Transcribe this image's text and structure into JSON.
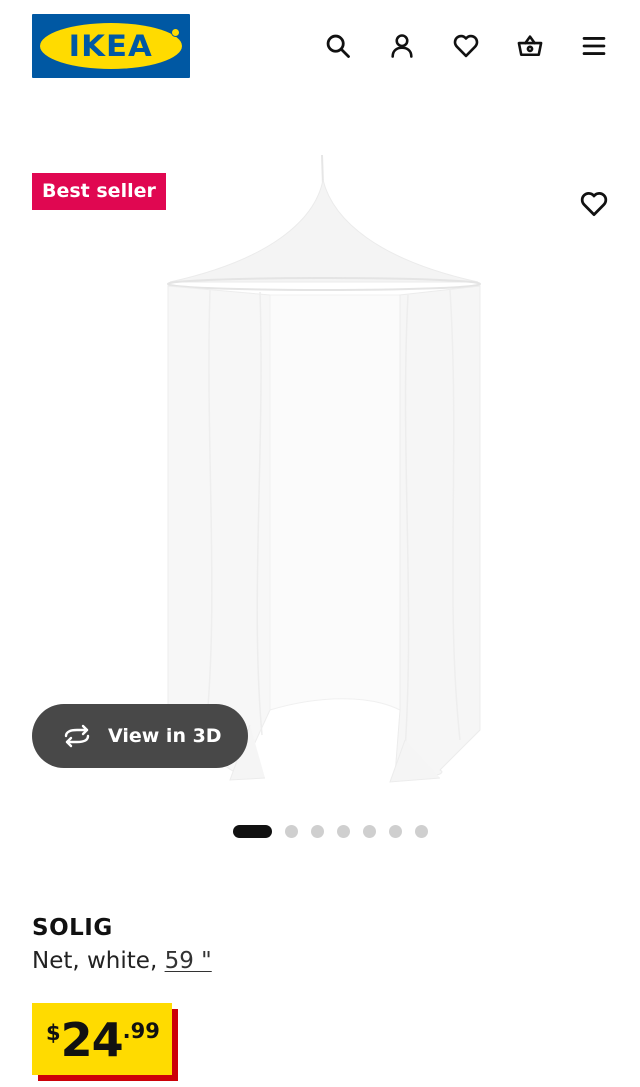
{
  "header": {
    "logo_text": "IKEA",
    "icons": [
      "search-icon",
      "account-icon",
      "heart-icon",
      "basket-icon",
      "menu-icon"
    ]
  },
  "product_media": {
    "badge": "Best seller",
    "view_3d_label": "View in 3D",
    "carousel": {
      "total": 7,
      "active_index": 1
    }
  },
  "product": {
    "name": "SOLIG",
    "description_prefix": "Net, white,",
    "size_link": "59 \"",
    "price": {
      "currency": "$",
      "whole": "24",
      "decimal": ".99"
    }
  },
  "colors": {
    "ikea_blue": "#0058a3",
    "ikea_yellow": "#ffdb00",
    "badge_red": "#e00751",
    "price_shadow": "#cc0008",
    "view3d_bg": "#484848"
  }
}
